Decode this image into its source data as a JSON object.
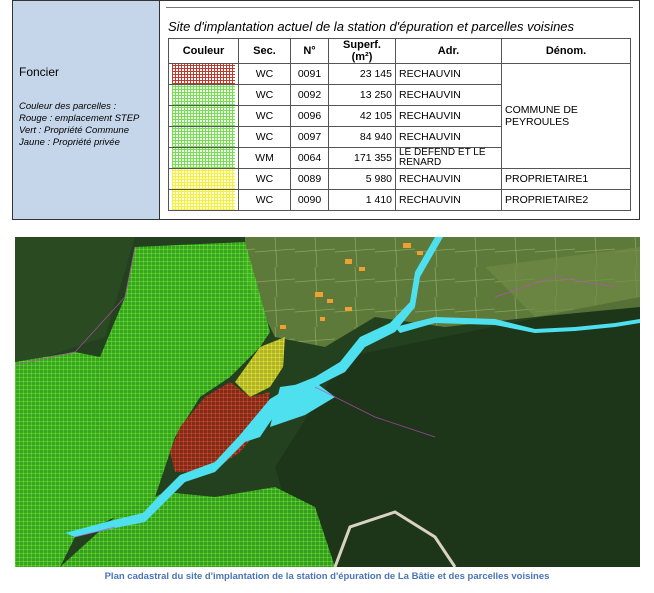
{
  "left_panel": {
    "title": "Foncier",
    "legend_lines": [
      "Couleur des parcelles :",
      "Rouge : emplacement STEP",
      "Vert : Propriété Commune",
      "Jaune : Propriété privée"
    ]
  },
  "table": {
    "title": "Site d'implantation actuel de la station d'épuration et parcelles voisines",
    "headers": [
      "Couleur",
      "Sec.",
      "N°",
      "Superf. (m²)",
      "Adr.",
      "Dénom."
    ],
    "rows": [
      {
        "color": "red",
        "sec": "WC",
        "num": "0091",
        "superf": "23 145",
        "adr": "RECHAUVIN"
      },
      {
        "color": "green",
        "sec": "WC",
        "num": "0092",
        "superf": "13 250",
        "adr": "RECHAUVIN"
      },
      {
        "color": "green",
        "sec": "WC",
        "num": "0096",
        "superf": "42 105",
        "adr": "RECHAUVIN"
      },
      {
        "color": "green",
        "sec": "WC",
        "num": "0097",
        "superf": "84 940",
        "adr": "RECHAUVIN"
      },
      {
        "color": "green",
        "sec": "WM",
        "num": "0064",
        "superf": "171 355",
        "adr": "LE DEFEND ET LE RENARD"
      },
      {
        "color": "yellow",
        "sec": "WC",
        "num": "0089",
        "superf": "5 980",
        "adr": "RECHAUVIN"
      },
      {
        "color": "yellow",
        "sec": "WC",
        "num": "0090",
        "superf": "1 410",
        "adr": "RECHAUVIN"
      }
    ],
    "denom_merged": "COMMUNE DE PEYROULES",
    "denom_row6": "PROPRIETAIRE1",
    "denom_row7": "PROPRIETAIRE2"
  },
  "colors": {
    "left_panel_bg": "#c6d6ea",
    "parcel_red": "#c0392b",
    "parcel_green": "#7ed957",
    "parcel_yellow": "#f3ef45",
    "river": "#4fe0f0",
    "caption": "#4a75b8"
  },
  "caption": "Plan cadastral du site d'implantation de la station d'épuration de La Bâtie et des parcelles voisines"
}
